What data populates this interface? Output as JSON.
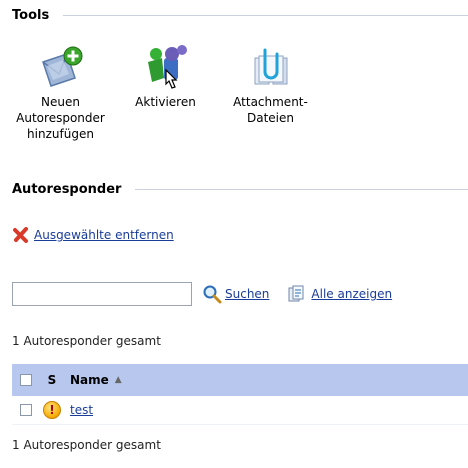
{
  "tools": {
    "title": "Tools",
    "items": [
      {
        "label": "Neuen\nAutoresponder\nhinzufügen",
        "icon": "envelope-add-icon"
      },
      {
        "label": "Aktivieren",
        "icon": "activate-users-icon"
      },
      {
        "label": "Attachment-\nDateien",
        "icon": "attachment-files-icon"
      }
    ]
  },
  "autoresponder": {
    "title": "Autoresponder",
    "remove_label": "Ausgewählte entfernen",
    "search": {
      "value": "",
      "placeholder": "",
      "search_label": "Suchen",
      "show_all_label": "Alle anzeigen"
    },
    "count_top": "1 Autoresponder gesamt",
    "count_bottom": "1 Autoresponder gesamt",
    "table": {
      "col_s": "S",
      "col_name": "Name",
      "sort_indicator": "▲",
      "rows": [
        {
          "name": "test",
          "status": "!"
        }
      ]
    }
  },
  "colors": {
    "header_bg": "#b7c7ee",
    "link": "#1a3d99"
  }
}
